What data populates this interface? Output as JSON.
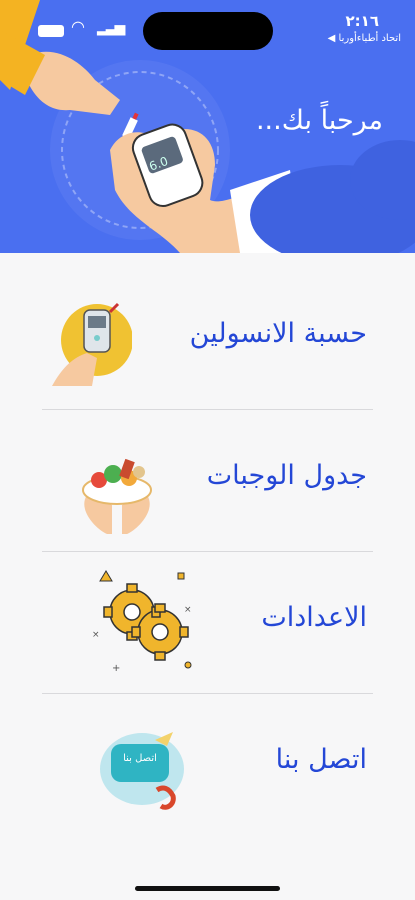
{
  "status_bar": {
    "time": "٢:١٦",
    "carrier": "◀ اتحاد أطباءأوربا"
  },
  "header": {
    "welcome_text": "مرحباً بك...",
    "illustration": "glucose-meter-illustration",
    "background_color": "#4a6ff0"
  },
  "menu": {
    "items": [
      {
        "label": "حسبة الانسولين",
        "icon": "insulin-meter-icon"
      },
      {
        "label": "جدول الوجبات",
        "icon": "meals-icon"
      },
      {
        "label": "الاعدادات",
        "icon": "gears-icon"
      },
      {
        "label": "اتصل بنا",
        "icon": "contact-icon",
        "icon_text": "اتصل بنا"
      }
    ]
  },
  "colors": {
    "accent": "#2447d6",
    "background": "#f7f7f8"
  }
}
